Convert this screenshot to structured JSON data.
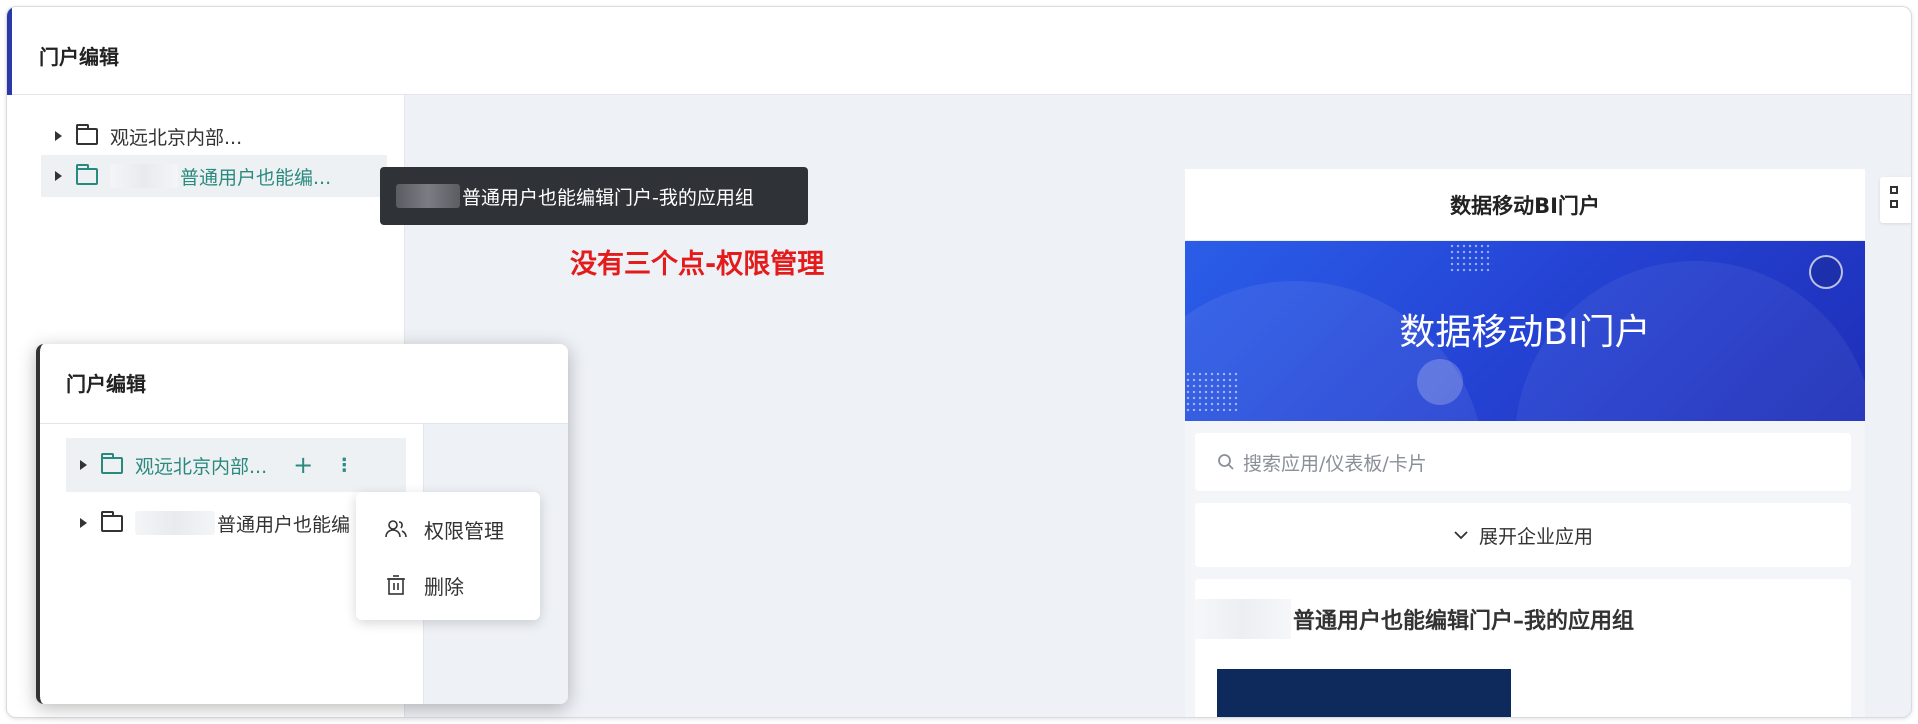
{
  "header": {
    "title": "门户编辑"
  },
  "tree": {
    "items": [
      {
        "label": "观远北京内部..."
      },
      {
        "label": "普通用户也能编..."
      }
    ]
  },
  "tooltip": {
    "text": "普通用户也能编辑门户-我的应用组"
  },
  "annotation": {
    "text": "没有三个点-权限管理"
  },
  "inset": {
    "title": "门户编辑",
    "items": [
      {
        "label": "观远北京内部...",
        "add": "+",
        "more": "⋮"
      },
      {
        "label": "普通用户也能编"
      }
    ],
    "menu": [
      {
        "label": "权限管理",
        "icon": "users-icon"
      },
      {
        "label": "删除",
        "icon": "trash-icon"
      }
    ]
  },
  "preview": {
    "title": "数据移动BI门户",
    "banner_title": "数据移动BI门户",
    "search_placeholder": "搜索应用/仪表板/卡片",
    "expand_label": "展开企业应用",
    "group_title": "普通用户也能编辑门户–我的应用组"
  },
  "colors": {
    "accent": "#2b8a7e",
    "annotation": "#e41b1b",
    "banner": "#2545d6"
  }
}
